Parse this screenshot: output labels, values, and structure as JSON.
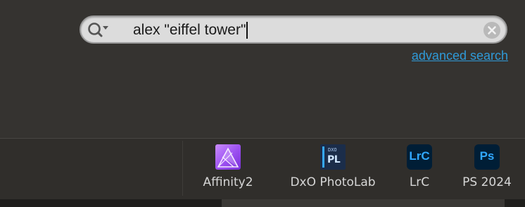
{
  "search": {
    "query": "alex \"eiffel tower\"",
    "advanced_link": "advanced search"
  },
  "apps": [
    {
      "label": "Affinity2",
      "icon": "affinity-photo-icon",
      "color": "#a05cf0"
    },
    {
      "label": "DxO PhotoLab",
      "icon": "dxo-photolab-icon",
      "icon_text": "PL",
      "icon_subtext": "DXO",
      "color": "#36a8ff"
    },
    {
      "label": "LrC",
      "icon": "lightroom-classic-icon",
      "icon_text": "LrC",
      "color": "#31a8ff"
    },
    {
      "label": "PS 2024",
      "icon": "photoshop-icon",
      "icon_text": "Ps",
      "color": "#31a8ff"
    }
  ],
  "colors": {
    "background": "#33312e",
    "search_field": "#dcdcdc",
    "link": "#2f9ad8",
    "app_label": "#d6d6d6"
  }
}
